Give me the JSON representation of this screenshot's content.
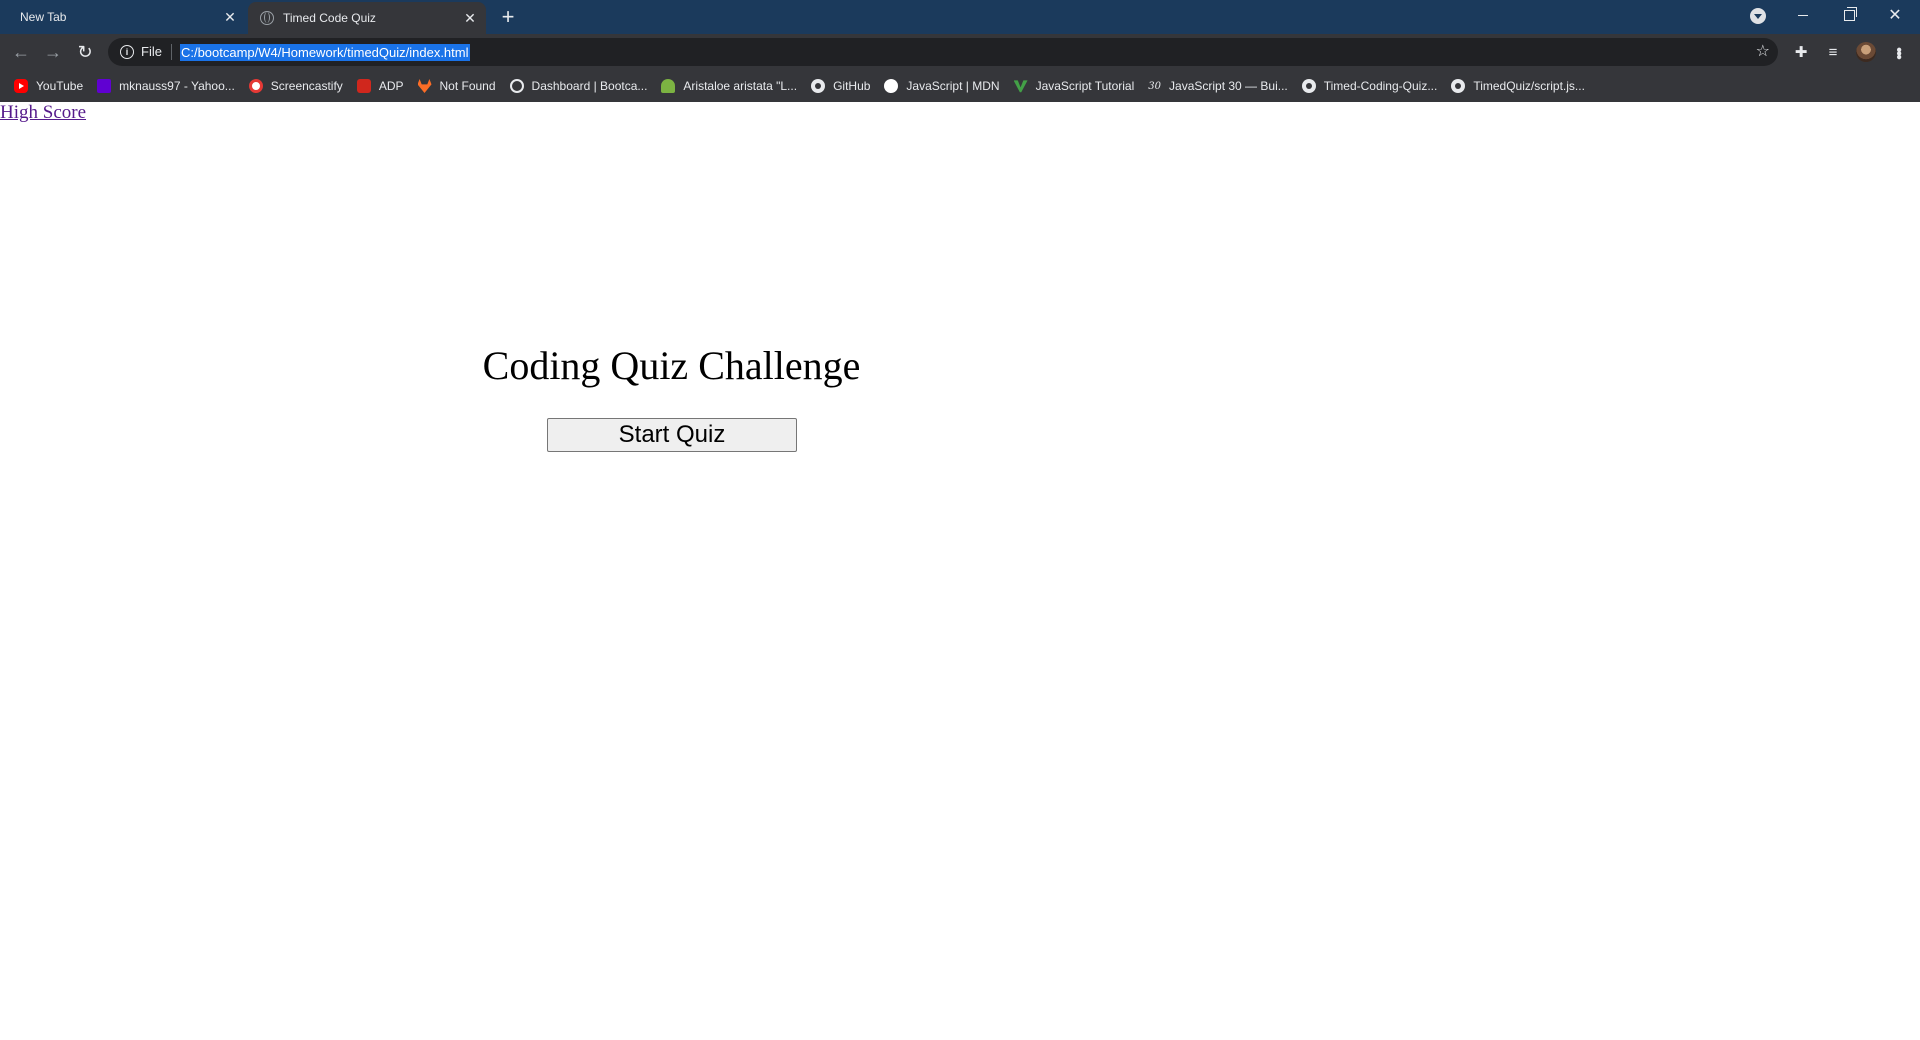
{
  "browser": {
    "tabs": [
      {
        "label": "New Tab",
        "active": false
      },
      {
        "label": "Timed Code Quiz",
        "active": true
      }
    ],
    "new_tab_symbol": "+",
    "address_bar": {
      "scheme_label": "File",
      "url": "C:/bootcamp/W4/Homework/timedQuiz/index.html"
    },
    "bookmarks": [
      {
        "label": "YouTube",
        "icon": "youtube-icon"
      },
      {
        "label": "mknauss97 - Yahoo...",
        "icon": "yahoo-icon"
      },
      {
        "label": "Screencastify",
        "icon": "screencastify-icon"
      },
      {
        "label": "ADP",
        "icon": "adp-icon"
      },
      {
        "label": "Not Found",
        "icon": "gitlab-icon"
      },
      {
        "label": "Dashboard | Bootca...",
        "icon": "globe-icon"
      },
      {
        "label": "Aristaloe aristata \"L...",
        "icon": "plant-icon"
      },
      {
        "label": "GitHub",
        "icon": "github-icon"
      },
      {
        "label": "JavaScript | MDN",
        "icon": "mdn-icon"
      },
      {
        "label": "JavaScript Tutorial",
        "icon": "jstutorial-icon"
      },
      {
        "label": "JavaScript 30 — Bui...",
        "icon": "js30-icon"
      },
      {
        "label": "Timed-Coding-Quiz...",
        "icon": "github-icon"
      },
      {
        "label": "TimedQuiz/script.js...",
        "icon": "github-icon"
      }
    ],
    "js30_badge": "30"
  },
  "page": {
    "high_score_link": "High Score",
    "title": "Coding Quiz Challenge",
    "start_button": "Start Quiz"
  },
  "colors": {
    "tabstrip": "#1b3a5c",
    "toolbar": "#35363a",
    "url_selection": "#1a73e8",
    "visited_link": "#551a8b"
  }
}
